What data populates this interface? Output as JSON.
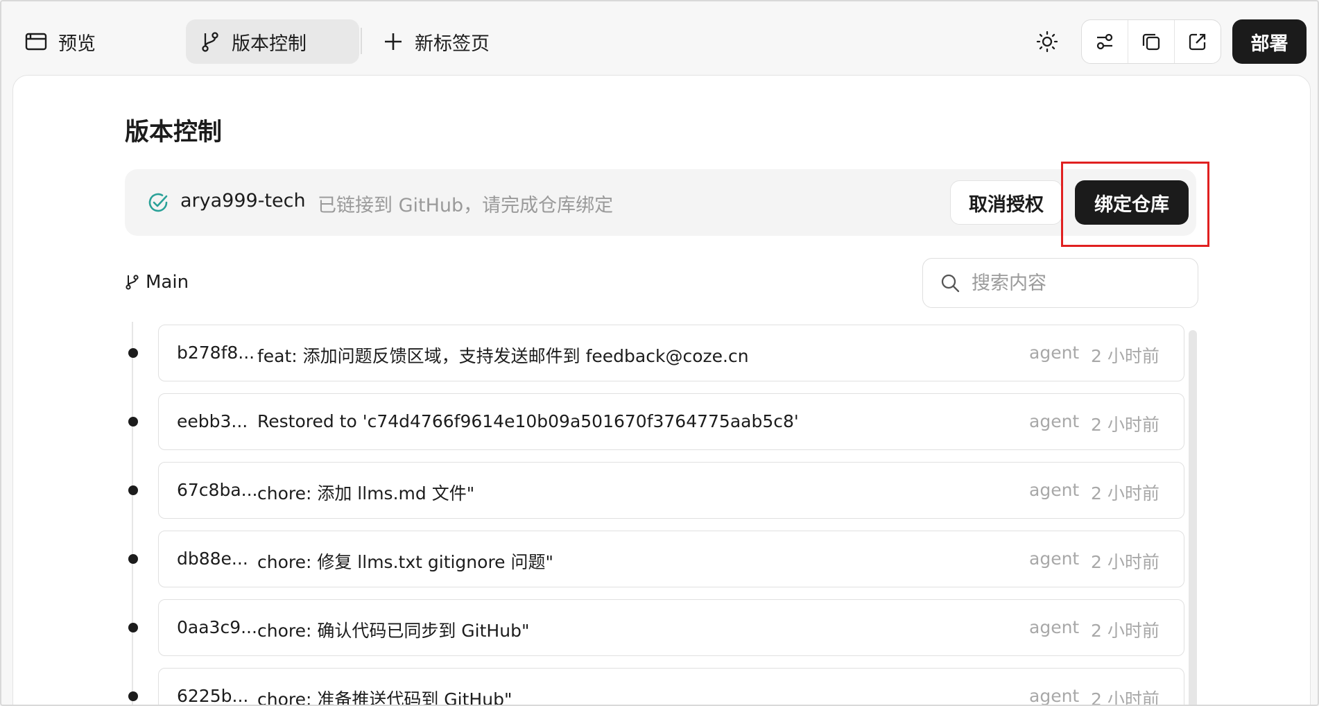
{
  "topbar": {
    "tabs": [
      {
        "label": "预览",
        "icon": "browser-window-icon"
      },
      {
        "label": "版本控制",
        "icon": "git-branch-icon"
      },
      {
        "label": "新标签页",
        "icon": "plus-icon"
      }
    ],
    "deploy_label": "部署"
  },
  "page": {
    "title": "版本控制"
  },
  "status": {
    "username": "arya999-tech",
    "message": "已链接到 GitHub，请完成仓库绑定",
    "revoke_label": "取消授权",
    "bind_label": "绑定仓库"
  },
  "branch": {
    "name": "Main"
  },
  "search": {
    "placeholder": "搜索内容"
  },
  "commits": [
    {
      "hash": "b278f8...",
      "message": "feat: 添加问题反馈区域，支持发送邮件到 feedback@coze.cn",
      "author": "agent",
      "time": "2 小时前"
    },
    {
      "hash": "eebb3...",
      "message": "Restored to 'c74d4766f9614e10b09a501670f3764775aab5c8'",
      "author": "agent",
      "time": "2 小时前"
    },
    {
      "hash": "67c8ba...",
      "message": "chore: 添加 llms.md 文件\"",
      "author": "agent",
      "time": "2 小时前"
    },
    {
      "hash": "db88e...",
      "message": "chore: 修复 llms.txt gitignore 问题\"",
      "author": "agent",
      "time": "2 小时前"
    },
    {
      "hash": "0aa3c9...",
      "message": "chore: 确认代码已同步到 GitHub\"",
      "author": "agent",
      "time": "2 小时前"
    },
    {
      "hash": "6225b...",
      "message": "chore: 准备推送代码到 GitHub\"",
      "author": "agent",
      "time": "2 小时前"
    }
  ],
  "colors": {
    "accent_check": "#2aa198",
    "dark_button": "#1b1b1b",
    "highlight_box": "#e02020"
  }
}
